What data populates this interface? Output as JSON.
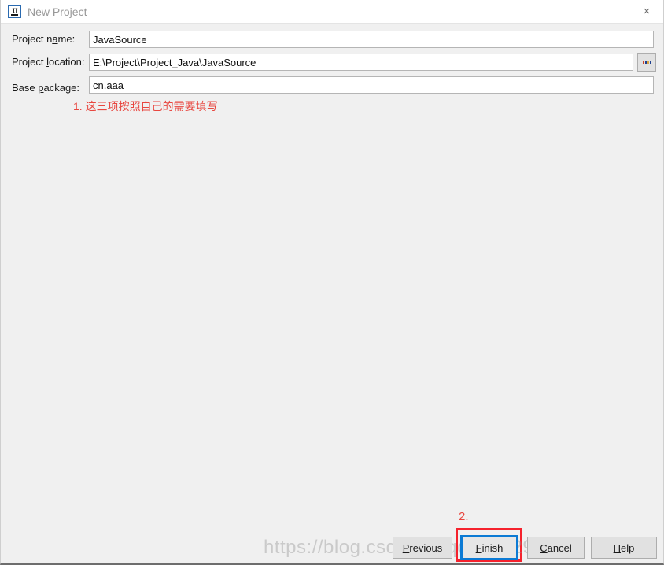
{
  "window": {
    "title": "New Project",
    "icon": "intellij-idea-icon",
    "close_label": "×"
  },
  "form": {
    "fields": [
      {
        "label_before": "Project n",
        "label_mnemonic": "a",
        "label_after": "me:",
        "value": "JavaSource",
        "placeholder": ""
      },
      {
        "label_before": "Project ",
        "label_mnemonic": "l",
        "label_after": "ocation:",
        "value": "E:\\Project\\Project_Java\\JavaSource",
        "placeholder": ""
      },
      {
        "label_before": "Base ",
        "label_mnemonic": "p",
        "label_after": "ackage:",
        "value": "cn.aaa",
        "placeholder": ""
      }
    ],
    "browse_button_label": "..."
  },
  "annotations": {
    "step1": "1. 这三项按照自己的需要填写",
    "step2": "2.",
    "color": "#e8463f",
    "highlight_color": "#f5222d"
  },
  "buttons": {
    "previous": {
      "before": "",
      "mnemonic": "P",
      "after": "revious"
    },
    "finish": {
      "before": "",
      "mnemonic": "F",
      "after": "inish"
    },
    "cancel": {
      "before": "",
      "mnemonic": "C",
      "after": "ancel"
    },
    "help": {
      "before": "",
      "mnemonic": "H",
      "after": "elp"
    }
  },
  "watermark": {
    "text": "https://blog.csdn.net/qq_26629387"
  },
  "colors": {
    "dialog_background": "#f0f0f0",
    "titlebar_background": "#ffffff",
    "input_background": "#ffffff",
    "focus_border": "#0b7ad4",
    "button_face": "#e1e1e1"
  }
}
